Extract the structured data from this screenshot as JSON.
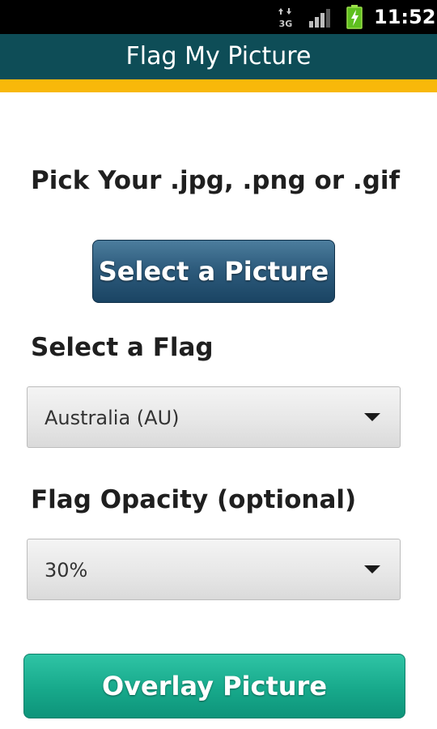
{
  "status_bar": {
    "network_icon": "3g-data-icon",
    "signal_icon": "signal-strength-icon",
    "battery_icon": "battery-charging-icon",
    "time": "11:52"
  },
  "app": {
    "title": "Flag My Picture",
    "accent_color": "#f8b80a",
    "title_bar_color": "#0e4d57"
  },
  "form": {
    "pick_heading": "Pick Your .jpg, .png or .gif",
    "select_picture_label": "Select a Picture",
    "flag_heading": "Select a Flag",
    "flag_selected": "Australia (AU)",
    "opacity_heading": "Flag Opacity (optional)",
    "opacity_selected": "30%",
    "overlay_label": "Overlay Picture"
  }
}
